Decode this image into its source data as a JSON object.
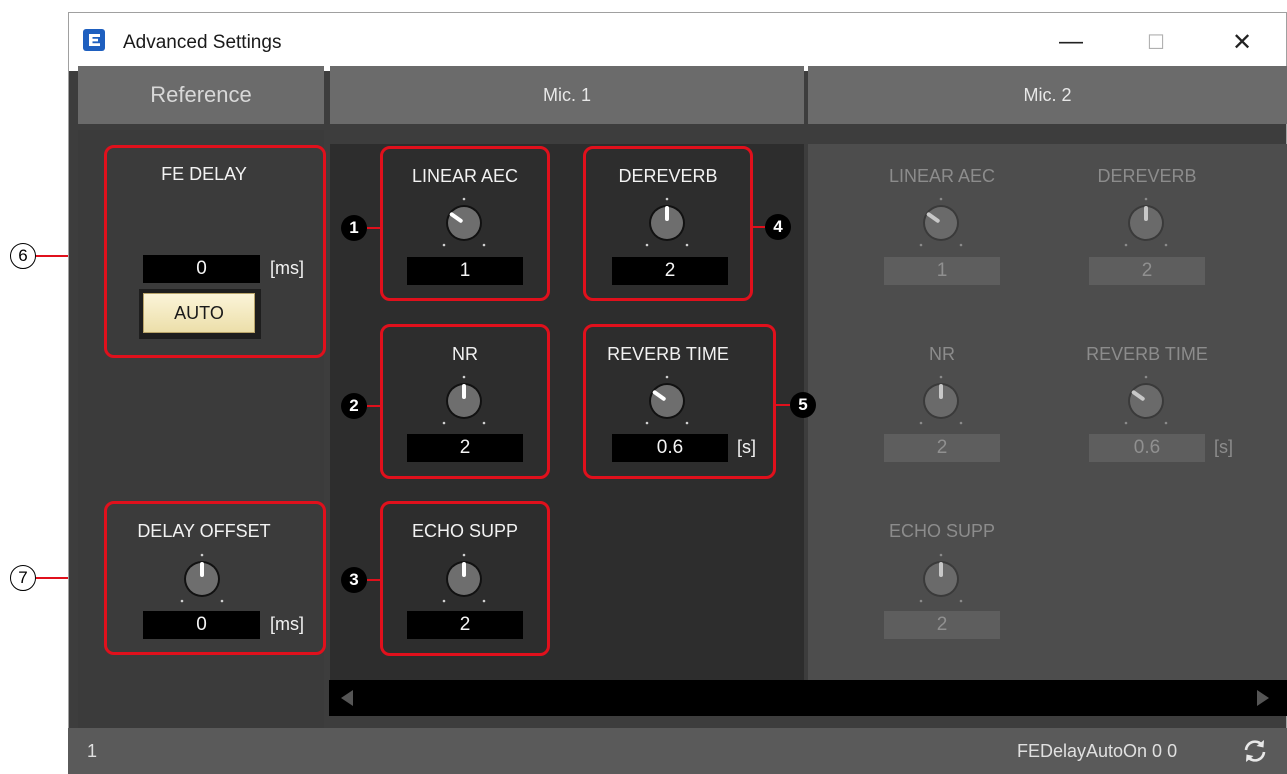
{
  "window": {
    "title": "Advanced Settings",
    "minimize_glyph": "—",
    "maximize_glyph": "☐",
    "close_glyph": "✕"
  },
  "columns": {
    "reference": "Reference",
    "mic1": "Mic. 1",
    "mic2": "Mic. 2"
  },
  "reference": {
    "fe_delay": {
      "label": "FE DELAY",
      "value": "0",
      "unit": "[ms]",
      "auto_label": "AUTO"
    },
    "delay_offset": {
      "label": "DELAY OFFSET",
      "value": "0",
      "unit": "[ms]"
    }
  },
  "mic1": {
    "linear_aec": {
      "label": "LINEAR AEC",
      "value": "1"
    },
    "dereverb": {
      "label": "DEREVERB",
      "value": "2"
    },
    "nr": {
      "label": "NR",
      "value": "2"
    },
    "reverb_time": {
      "label": "REVERB TIME",
      "value": "0.6",
      "unit": "[s]"
    },
    "echo_supp": {
      "label": "ECHO SUPP",
      "value": "2"
    }
  },
  "mic2": {
    "linear_aec": {
      "label": "LINEAR AEC",
      "value": "1"
    },
    "dereverb": {
      "label": "DEREVERB",
      "value": "2"
    },
    "nr": {
      "label": "NR",
      "value": "2"
    },
    "reverb_time": {
      "label": "REVERB TIME",
      "value": "0.6",
      "unit": "[s]"
    },
    "echo_supp": {
      "label": "ECHO SUPP",
      "value": "2"
    }
  },
  "callouts": [
    "1",
    "2",
    "3",
    "4",
    "5",
    "6",
    "7"
  ],
  "status": {
    "left": "1",
    "right": "FEDelayAutoOn 0 0"
  },
  "colors": {
    "accent_red": "#e0101c",
    "auto_button": "#f3e8b8",
    "app_icon": "#1e5fbf"
  }
}
